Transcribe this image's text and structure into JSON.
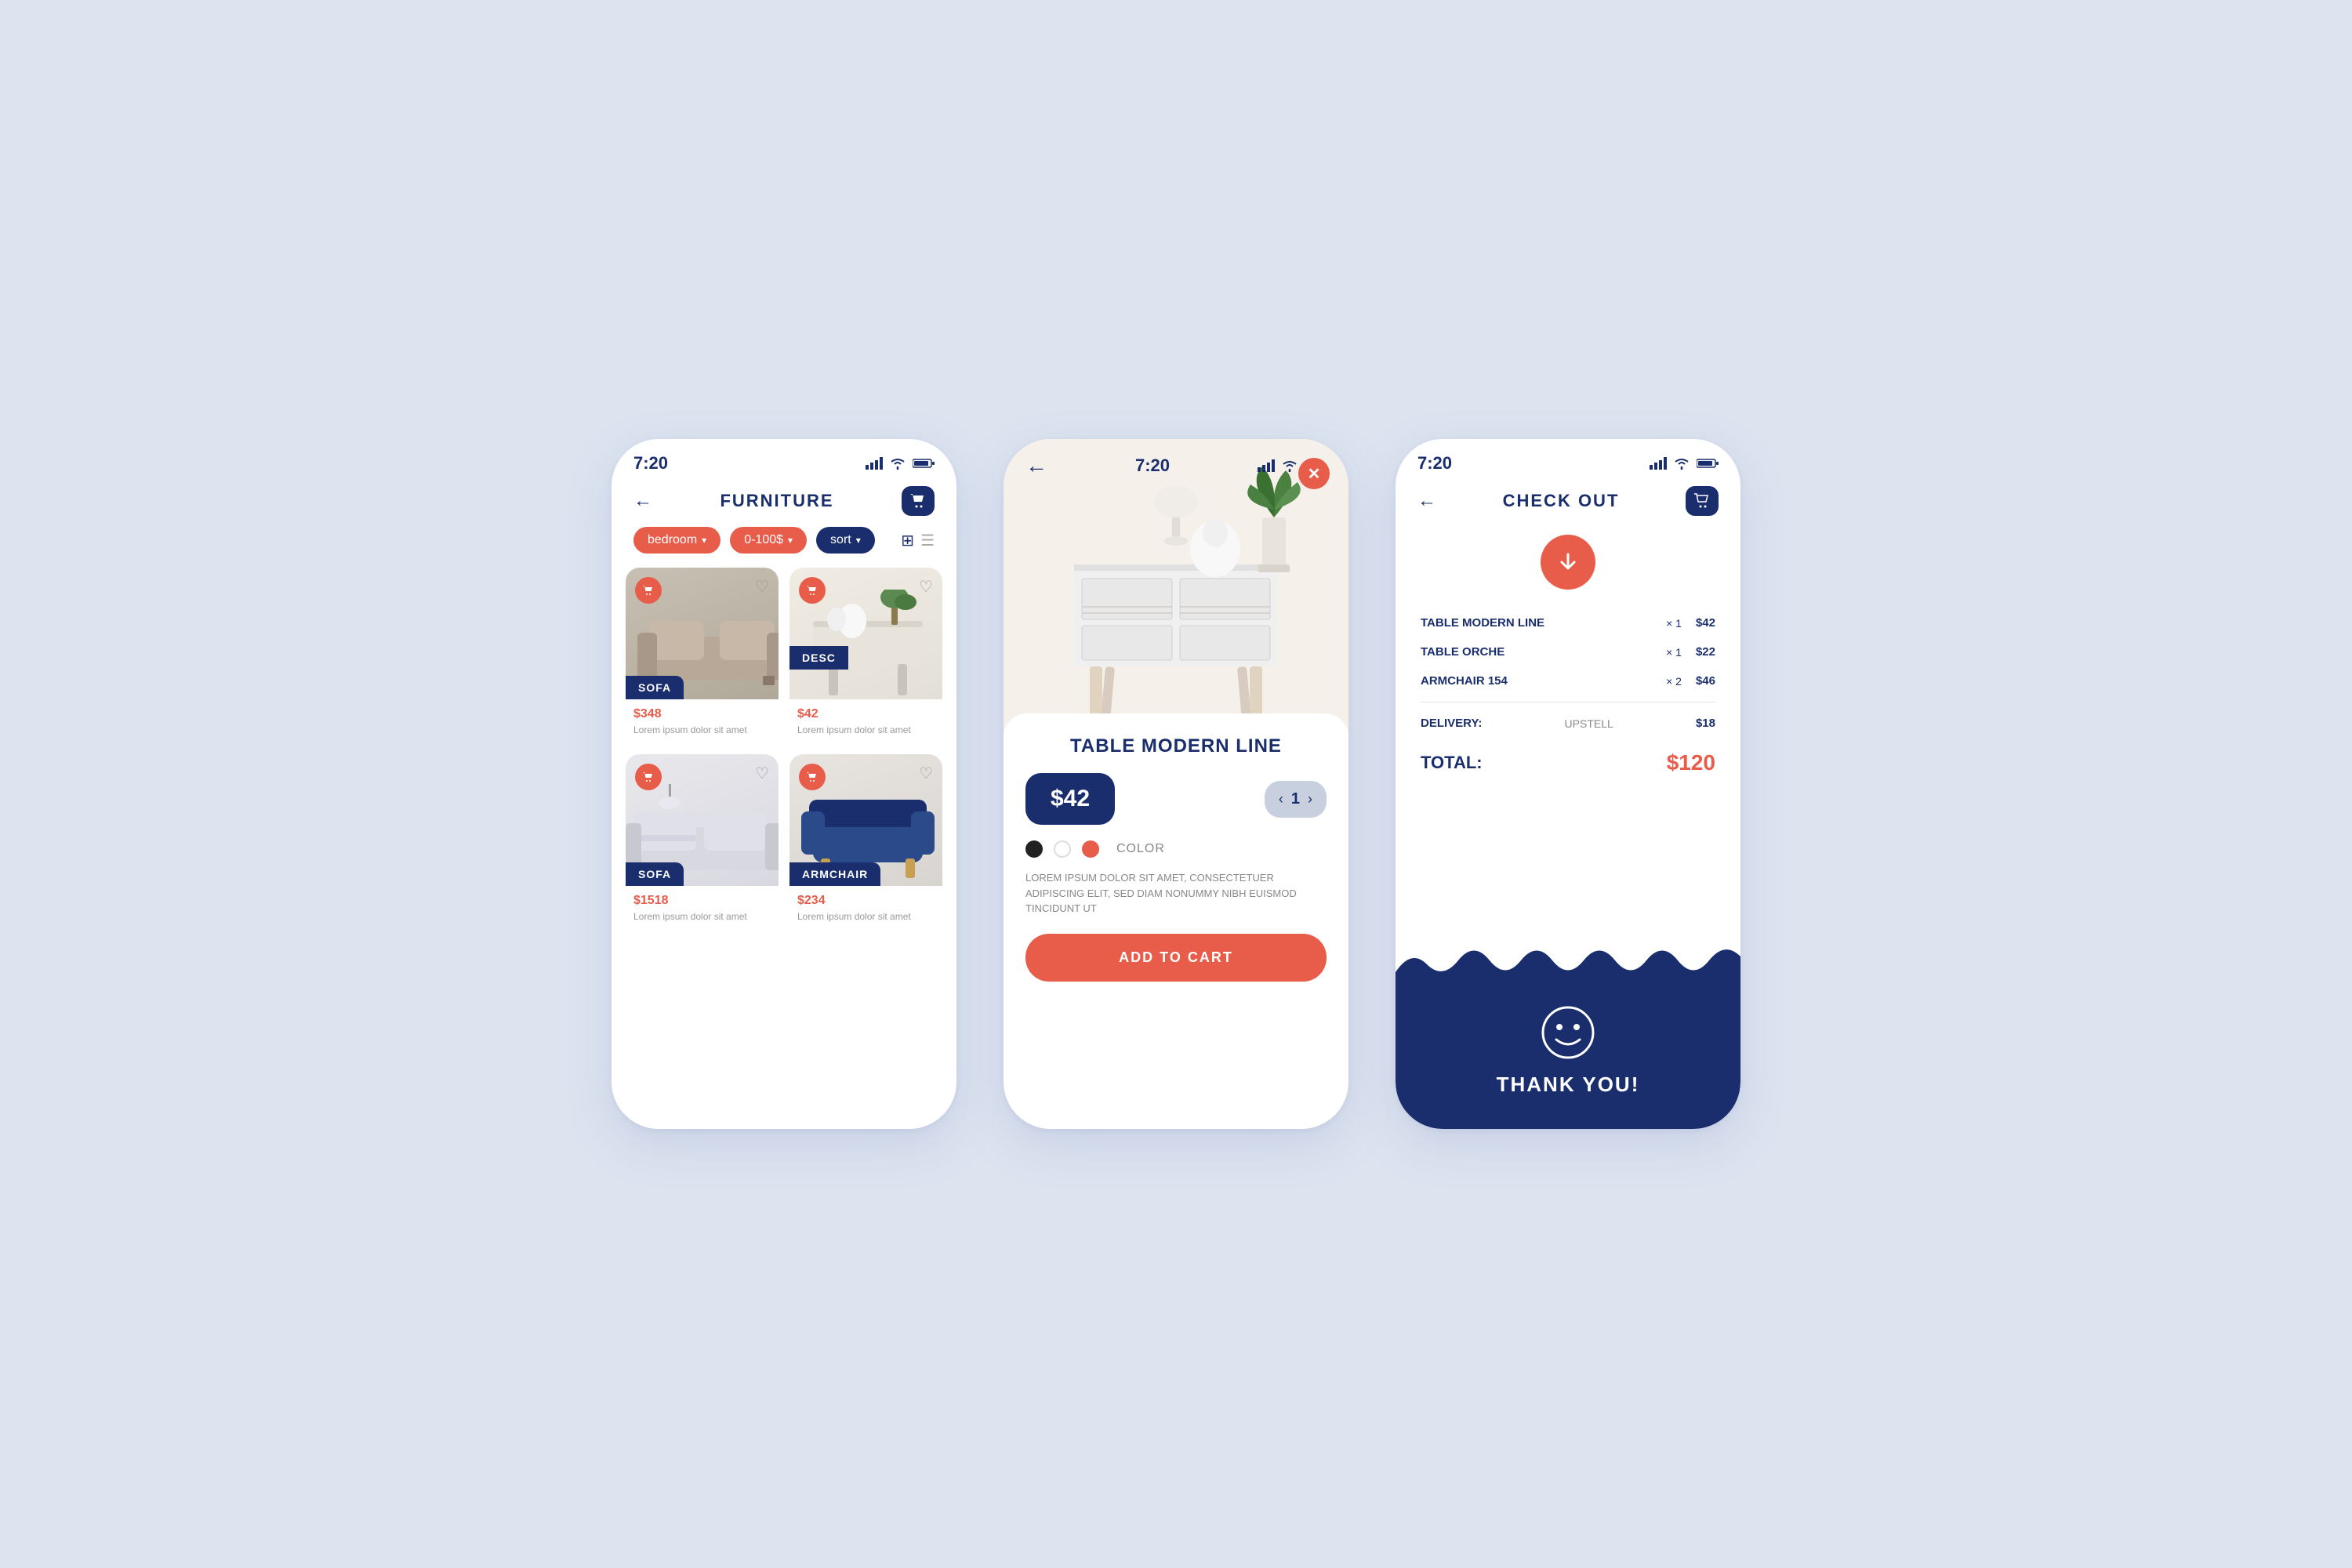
{
  "app": {
    "background": "#dde4f0",
    "accent_coral": "#e85c4a",
    "accent_navy": "#1a2e6e"
  },
  "phone1": {
    "status_time": "7:20",
    "title": "FURNITURE",
    "filters": [
      {
        "label": "bedroom",
        "has_chevron": true
      },
      {
        "label": "0-100$",
        "has_chevron": true
      },
      {
        "label": "sort",
        "has_chevron": true
      }
    ],
    "products": [
      {
        "name": "SOFA",
        "price": "$348",
        "desc": "Lorem ipsum dolor sit amet",
        "label_type": "name"
      },
      {
        "name": "DESC",
        "price": "$42",
        "desc": "Lorem ipsum dolor sit amet",
        "label_type": "desc"
      },
      {
        "name": "SOFA",
        "price": "$1518",
        "desc": "Lorem ipsum dolor sit amet",
        "label_type": "name"
      },
      {
        "name": "ARMCHAIR",
        "price": "$234",
        "desc": "Lorem ipsum dolor sit amet",
        "label_type": "name"
      }
    ]
  },
  "phone2": {
    "status_time": "7:20",
    "product_name": "TABLE MODERN LINE",
    "price": "$42",
    "quantity": "1",
    "color_label": "COLOR",
    "description": "LOREM IPSUM DOLOR SIT AMET, CONSECTETUER ADIPISCING ELIT, SED DIAM NONUMMY NIBH EUISMOD TINCIDUNT UT",
    "add_to_cart": "ADD TO CART"
  },
  "phone3": {
    "status_time": "7:20",
    "title": "CHECK OUT",
    "items": [
      {
        "name": "TABLE MODERN LINE",
        "qty": "× 1",
        "price": "$42"
      },
      {
        "name": "TABLE ORCHE",
        "qty": "× 1",
        "price": "$22"
      },
      {
        "name": "ARMCHAIR 154",
        "qty": "× 2",
        "price": "$46"
      }
    ],
    "delivery_label": "DELIVERY:",
    "delivery_method": "UPSTELL",
    "delivery_price": "$18",
    "total_label": "TOTAL:",
    "total_price": "$120",
    "thank_you": "THANK YOU!"
  }
}
